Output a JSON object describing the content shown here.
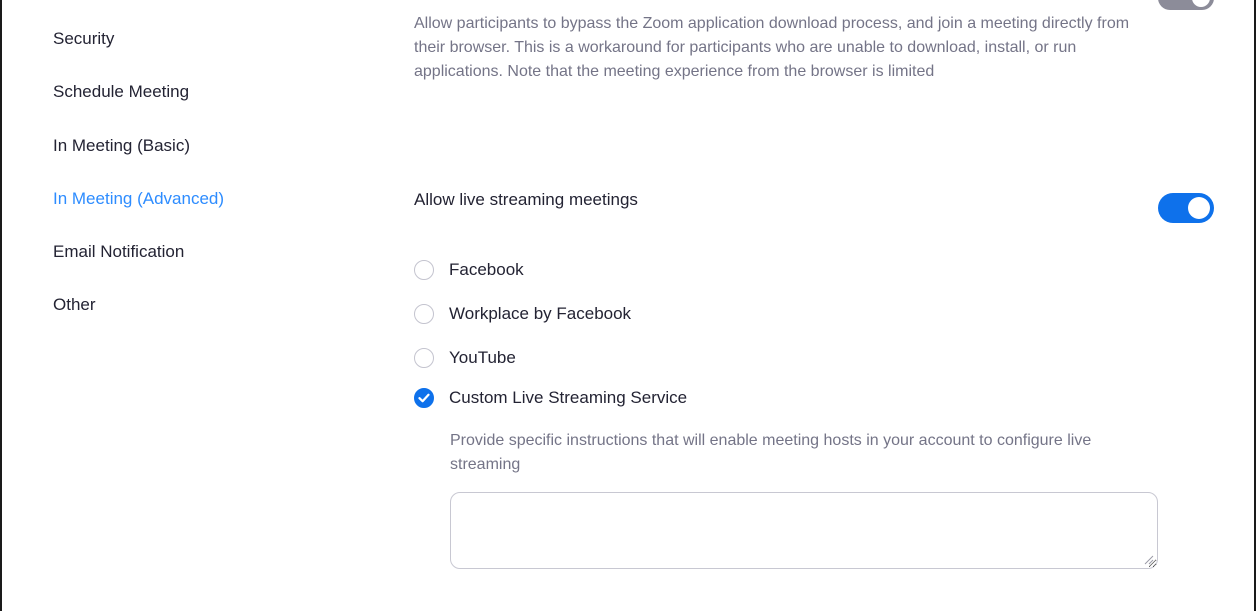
{
  "sidebar": {
    "items": [
      {
        "label": "Security",
        "active": false
      },
      {
        "label": "Schedule Meeting",
        "active": false
      },
      {
        "label": "In Meeting (Basic)",
        "active": false
      },
      {
        "label": "In Meeting (Advanced)",
        "active": true
      },
      {
        "label": "Email Notification",
        "active": false
      },
      {
        "label": "Other",
        "active": false
      }
    ]
  },
  "browser_join": {
    "description": "Allow participants to bypass the Zoom application download process, and join a meeting directly from their browser. This is a workaround for participants who are unable to download, install, or run applications. Note that the meeting experience from the browser is limited"
  },
  "live_streaming": {
    "title": "Allow live streaming meetings",
    "enabled": true,
    "options": [
      {
        "label": "Facebook",
        "checked": false
      },
      {
        "label": "Workplace by Facebook",
        "checked": false
      },
      {
        "label": "YouTube",
        "checked": false
      },
      {
        "label": "Custom Live Streaming Service",
        "checked": true
      }
    ],
    "instructions_label": "Provide specific instructions that will enable meeting hosts in your account to configure live streaming",
    "instructions_value": ""
  },
  "colors": {
    "accent": "#0E71EB",
    "active_nav": "#2D8CFF",
    "text": "#232333",
    "muted": "#747487"
  },
  "icons": {
    "checkmark": "check-icon",
    "toggle": "toggle-switch"
  }
}
